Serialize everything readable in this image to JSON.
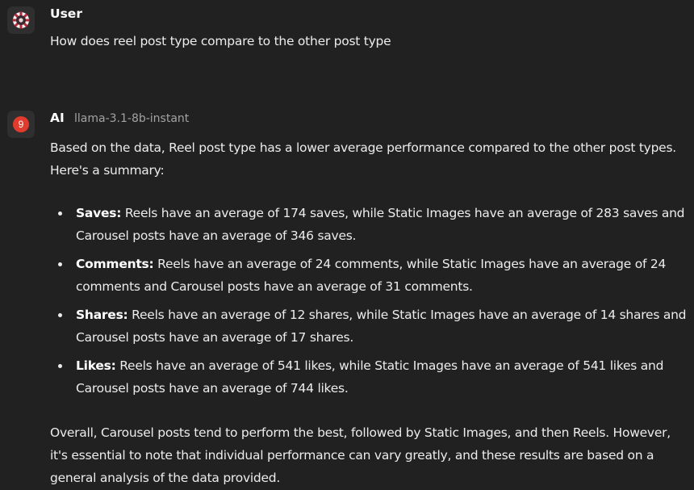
{
  "user_message": {
    "sender": "User",
    "avatar_icon": "gear-avatar-icon",
    "text": "How does reel post type compare to the other post type"
  },
  "ai_message": {
    "sender": "AI",
    "badge": "9",
    "badge_color": "#e03b2c",
    "model": "llama-3.1-8b-instant",
    "intro": "Based on the data, Reel post type has a lower average performance compared to the other post types. Here's a summary:",
    "points": [
      {
        "label": "Saves:",
        "text": " Reels have an average of 174 saves, while Static Images have an average of 283 saves and Carousel posts have an average of 346 saves."
      },
      {
        "label": "Comments:",
        "text": " Reels have an average of 24 comments, while Static Images have an average of 24 comments and Carousel posts have an average of 31 comments."
      },
      {
        "label": "Shares:",
        "text": " Reels have an average of 12 shares, while Static Images have an average of 14 shares and Carousel posts have an average of 17 shares."
      },
      {
        "label": "Likes:",
        "text": " Reels have an average of 541 likes, while Static Images have an average of 541 likes and Carousel posts have an average of 744 likes."
      }
    ],
    "conclusion": "Overall, Carousel posts tend to perform the best, followed by Static Images, and then Reels. However, it's essential to note that individual performance can vary greatly, and these results are based on a general analysis of the data provided."
  }
}
